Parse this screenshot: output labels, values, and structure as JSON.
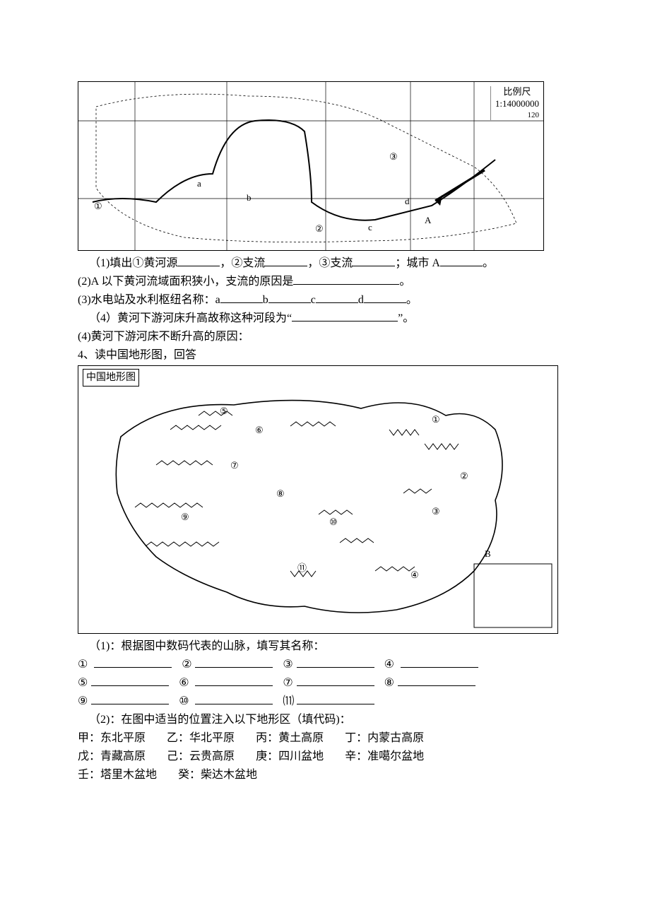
{
  "map1": {
    "scale_label": "比例尺",
    "scale_value": "1:14000000",
    "coord": "120",
    "markers": [
      "①",
      "②",
      "③",
      "a",
      "b",
      "c",
      "d",
      "A"
    ]
  },
  "q1": {
    "prefix": "（1)填出①黄河源",
    "mid1": "，②支流",
    "mid2": "，③支流",
    "mid3": "；城市 A",
    "end": "。"
  },
  "q2": {
    "text": "(2)A 以下黄河流域面积狭小，支流的原因是",
    "end": "。"
  },
  "q3": {
    "prefix": "(3)水电站及水利枢纽名称：a",
    "b": "b",
    "c": "c",
    "d": "d",
    "end": "。"
  },
  "q4": {
    "prefix": "（4）黄河下游河床升高故称这种河段为“",
    "end": "”。"
  },
  "q5": {
    "text": "(4)黄河下游河床不断升高的原因："
  },
  "sec4_title": "4、读中国地形图，回答",
  "map2_title": "中国地形图",
  "map2_markers": [
    "①",
    "②",
    "③",
    "④",
    "⑤",
    "⑥",
    "⑦",
    "⑧",
    "⑨",
    "⑩",
    "⑪",
    "B"
  ],
  "p1": {
    "title": "（1)：根据图中数码代表的山脉，填写其名称：",
    "nums": [
      "①",
      "②",
      "③",
      "④",
      "⑤",
      "⑥",
      "⑦",
      "⑧",
      "⑨",
      "⑩",
      "⑾"
    ]
  },
  "p2": {
    "title": "（2)：在图中适当的位置注入以下地形区（填代码)：",
    "items": [
      {
        "k": "甲：",
        "v": "东北平原"
      },
      {
        "k": "乙：",
        "v": "华北平原"
      },
      {
        "k": "丙：",
        "v": "黄土高原"
      },
      {
        "k": "丁：",
        "v": "内蒙古高原"
      },
      {
        "k": "戊：",
        "v": "青藏高原"
      },
      {
        "k": "己：",
        "v": "云贵高原"
      },
      {
        "k": "庚：",
        "v": "四川盆地"
      },
      {
        "k": "辛：",
        "v": "准噶尔盆地"
      },
      {
        "k": "壬：",
        "v": "塔里木盆地"
      },
      {
        "k": "癸：",
        "v": "柴达木盆地"
      }
    ]
  }
}
